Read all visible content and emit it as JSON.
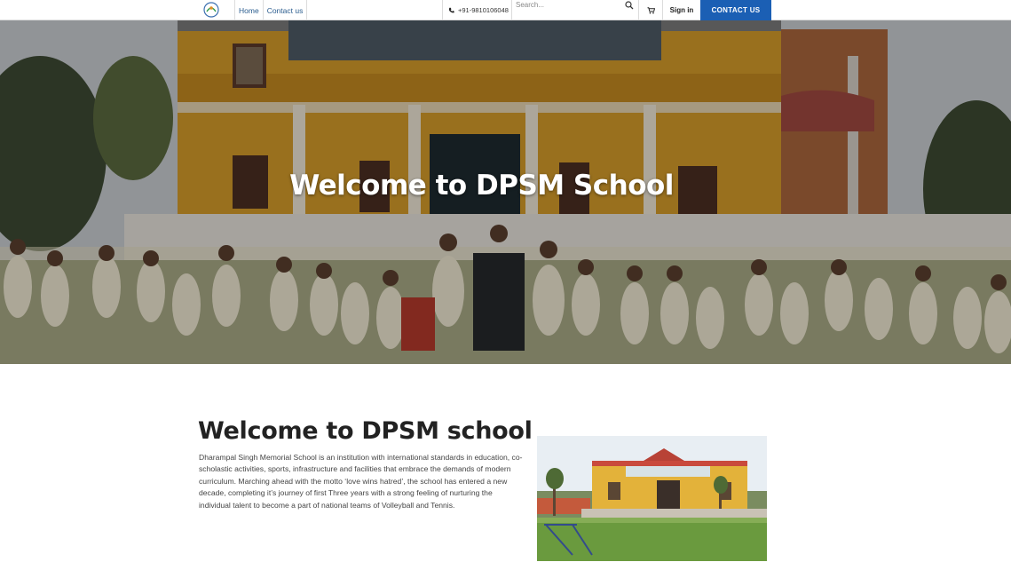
{
  "nav": {
    "logo_icon": "school-logo",
    "links": [
      "Home",
      "Contact us"
    ],
    "phone": "+91-9810106048",
    "search_placeholder": "Search...",
    "signin": "Sign in",
    "contact_button": "CONTACT US",
    "accent_color": "#1b5fb4"
  },
  "hero": {
    "title": "Welcome to DPSM School"
  },
  "welcome": {
    "title": "Welcome to DPSM school",
    "text": "Dharampal Singh Memorial School is an institution with international standards in education, co-scholastic activities, sports, infrastructure and facilities that embrace the demands of modern curriculum. Marching ahead with the motto ‘love wins hatred’, the school has entered a new decade, completing it’s journey of first Three years with a strong feeling of nurturing the individual talent to become a part of national teams of Volleyball and Tennis."
  }
}
